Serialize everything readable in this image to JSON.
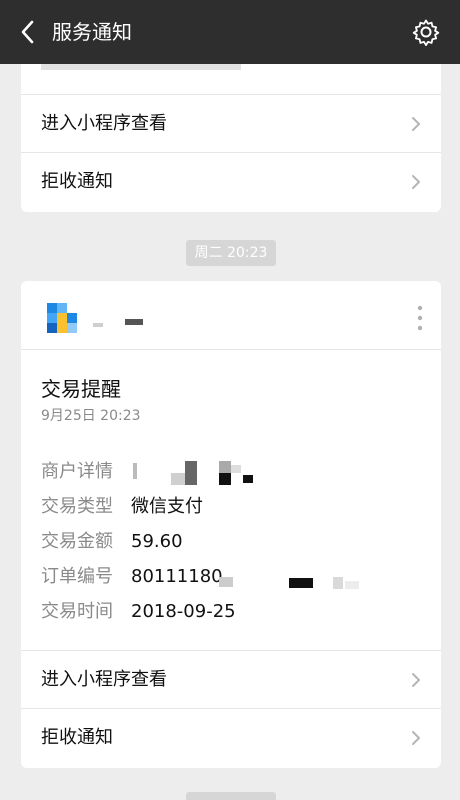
{
  "nav": {
    "title": "服务通知",
    "back_icon": "chevron-left-icon",
    "settings_icon": "gear-icon"
  },
  "top_card": {
    "rows": [
      {
        "label": "进入小程序查看"
      },
      {
        "label": "拒收通知"
      }
    ]
  },
  "timestamp_pill": "周二 20:23",
  "card": {
    "title": "交易提醒",
    "date": "9月25日  20:23",
    "fields": [
      {
        "key": "商户详情",
        "value": ""
      },
      {
        "key": "交易类型",
        "value": "微信支付"
      },
      {
        "key": "交易金额",
        "value": "59.60"
      },
      {
        "key": "订单编号",
        "value": "80111180"
      },
      {
        "key": "交易时间",
        "value": "2018-09-25"
      }
    ],
    "rows": [
      {
        "label": "进入小程序查看"
      },
      {
        "label": "拒收通知"
      }
    ]
  },
  "colors": {
    "nav_bg": "#2e2e2e",
    "page_bg": "#ededed",
    "secondary_text": "#8a8a8a"
  }
}
